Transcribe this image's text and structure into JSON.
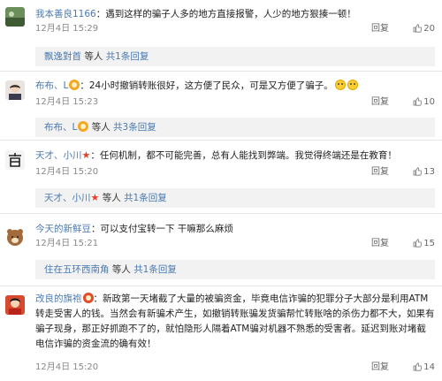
{
  "comments": [
    {
      "username": "我本善良1166",
      "text": "遇到这样的骗子人多的地方直接报警，人少的地方狠揍一顿！",
      "time": "12月4日 15:29",
      "reply_label": "回复",
      "likes": "20",
      "sub_reply": {
        "name": "飘逸對首",
        "etc": "等人",
        "count": "共1条回复"
      }
    },
    {
      "username": "布布、L",
      "text": "24小时撤销转账很好，这方便了民众，可是又方便了骗子。",
      "time": "12月4日 15:23",
      "reply_label": "回复",
      "likes": "10",
      "sub_reply": {
        "name": "布布、L",
        "etc": "等人",
        "count": "共3条回复"
      }
    },
    {
      "username": "天才、小川",
      "text": "任何机制，都不可能完善，总有人能找到弊端。我觉得终端还是在教育！",
      "time": "12月4日 15:20",
      "reply_label": "回复",
      "likes": "13",
      "sub_reply": {
        "name": "天才、小川",
        "etc": "等人",
        "count": "共1条回复"
      }
    },
    {
      "username": "今天的新鲜豆",
      "text": "可以支付宝转一下 干嘛那么麻烦",
      "time": "12月4日 15:21",
      "reply_label": "回复",
      "likes": "15",
      "sub_reply": {
        "name": "住在五环西南角",
        "etc": "等人",
        "count": "共1条回复"
      }
    },
    {
      "username": "改良的旗袍",
      "text": "新政第一天堵截了大量的被骗资金，毕竟电信诈骗的犯罪分子大部分是利用ATM转走受害人的钱。当然会有新骗术产生，如撤销转账骗发货骗帮忙转账啥的杀伤力都不大，如果有骗子现身，那正好抓跑不了的，就怕隐形人隔着ATM骗对机器不熟悉的受害者。延迟到账对堵截电信诈骗的资金流的确有效！",
      "time": "12月4日 15:20",
      "reply_label": "回复",
      "likes": "14"
    }
  ],
  "colors": {
    "username": "#4a7ab0",
    "meta": "#888888",
    "sub_bg": "#f2f2f2",
    "star": "#e8402b"
  },
  "icons": {
    "like": "thumbs-up-icon",
    "badge": "vip-badge-icon",
    "emoji": "crying-emoji-icon",
    "star": "star-icon"
  }
}
